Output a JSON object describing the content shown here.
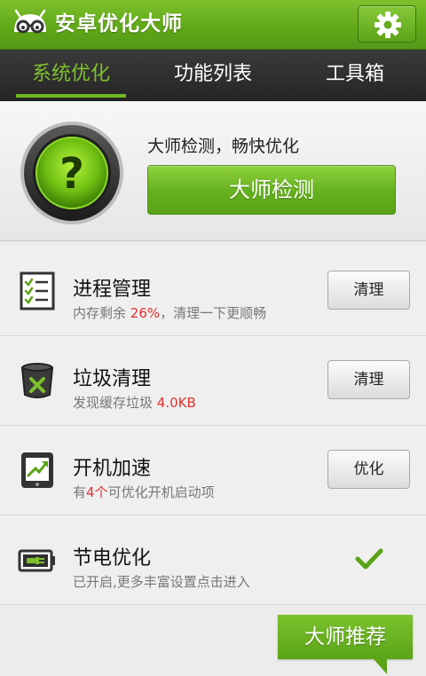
{
  "app": {
    "title": "安卓优化大师",
    "brand_color": "#6cb323"
  },
  "header": {
    "settings_icon": "gear-icon"
  },
  "tabs": [
    {
      "label": "系统优化",
      "active": true
    },
    {
      "label": "功能列表",
      "active": false
    },
    {
      "label": "工具箱",
      "active": false
    }
  ],
  "check": {
    "tagline": "大师检测，畅快优化",
    "button_label": "大师检测",
    "orb_icon": "question-mark-icon"
  },
  "items": [
    {
      "title": "进程管理",
      "sub_prefix": "内存剩余 ",
      "sub_highlight": "26%",
      "sub_suffix": "，清理一下更顺畅",
      "action_label": "清理",
      "icon": "checklist-icon"
    },
    {
      "title": "垃圾清理",
      "sub_prefix": "发现缓存垃圾 ",
      "sub_highlight": "4.0KB",
      "sub_suffix": "",
      "action_label": "清理",
      "icon": "trash-can-icon"
    },
    {
      "title": "开机加速",
      "sub_prefix": "有",
      "sub_highlight": "4个",
      "sub_suffix": "可优化开机启动项",
      "action_label": "优化",
      "icon": "phone-boost-icon"
    },
    {
      "title": "节电优化",
      "sub_prefix": "已开启,更多丰富设置点击进入",
      "sub_highlight": "",
      "sub_suffix": "",
      "status_icon": "checkmark-icon",
      "icon": "battery-plug-icon"
    }
  ],
  "recommend": {
    "label": "大师推荐"
  },
  "colors": {
    "highlight": "#e03232",
    "tab_active": "#7ec12d"
  }
}
